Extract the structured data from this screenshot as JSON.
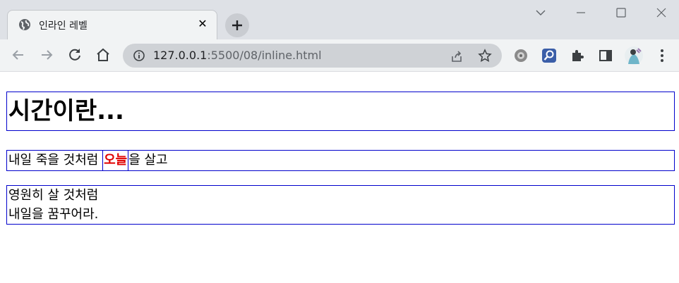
{
  "browser": {
    "tab": {
      "title": "인라인 레벨",
      "close_glyph": "✕"
    },
    "new_tab_label": "+",
    "address": {
      "host": "127.0.0.1",
      "path": ":5500/08/inline.html"
    }
  },
  "page": {
    "heading": "시간이란...",
    "line1": {
      "before": "내일 죽을 것처럼 ",
      "highlight": "오늘",
      "after": "을 살고"
    },
    "para2": {
      "line_a": "영원히 살 것처럼",
      "line_b": "내일을 꿈꾸어라."
    }
  },
  "colors": {
    "highlight": "#e00000",
    "border": "#0000cc",
    "chrome_bg": "#dee1e6",
    "toolbar_bg": "#f1f3f4"
  },
  "icons": [
    "globe-icon",
    "close-icon",
    "plus-icon",
    "chevron-down-icon",
    "minimize-icon",
    "maximize-icon",
    "window-close-icon",
    "back-icon",
    "forward-icon",
    "reload-icon",
    "home-icon",
    "info-icon",
    "share-icon",
    "star-icon",
    "settings-extension-icon",
    "search-extension-icon",
    "puzzle-icon",
    "side-panel-icon",
    "profile-avatar",
    "more-menu-icon"
  ]
}
